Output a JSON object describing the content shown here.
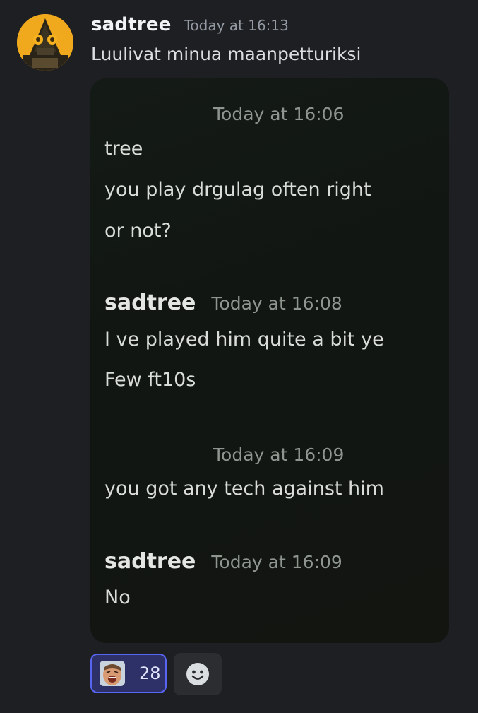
{
  "message": {
    "username": "sadtree",
    "timestamp": "Today at 16:13",
    "text": "Luulivat minua maanpetturiksi"
  },
  "embed": {
    "block1": {
      "time": "Today at 16:06",
      "lines": [
        "tree",
        "you play drgulag often right",
        "or not?"
      ]
    },
    "block2": {
      "username": "sadtree",
      "time": "Today at 16:08",
      "lines": [
        "I ve played him quite a bit ye",
        "Few ft10s"
      ]
    },
    "block3": {
      "time": "Today at 16:09",
      "lines": [
        "you got any tech against him"
      ]
    },
    "block4": {
      "username": "sadtree",
      "time": "Today at 16:09",
      "lines": [
        "No"
      ]
    }
  },
  "reactions": {
    "items": [
      {
        "emoji": "laughing-face-emoji",
        "count": "28",
        "active": true
      }
    ],
    "add_icon": "add-reaction-smiley-icon"
  },
  "colors": {
    "background": "#1e1f22",
    "username": "#f2f3f5",
    "timestamp": "#949ba4",
    "reaction_border": "#5865f2",
    "reaction_bg": "#2d3167"
  }
}
